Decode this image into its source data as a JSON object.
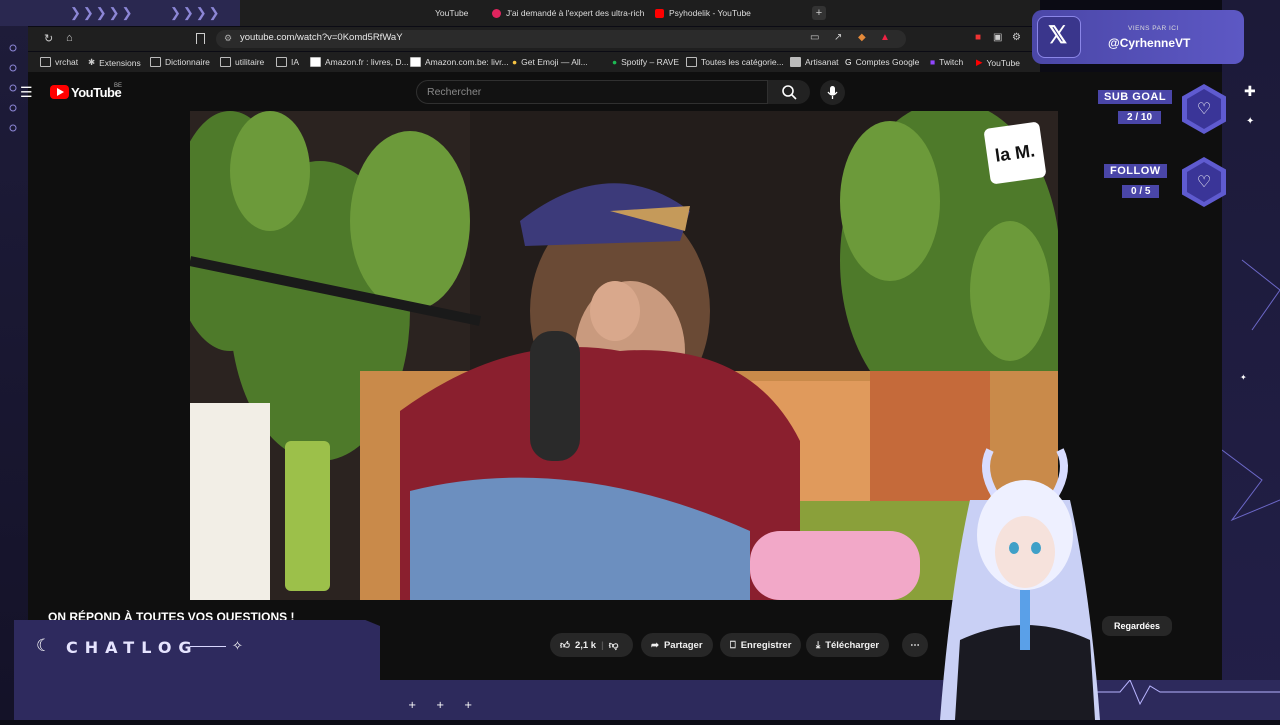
{
  "browser": {
    "tabs": [
      {
        "label": "YouTube",
        "active": false
      },
      {
        "label": "J'ai demandé à l'expert des ultra-rich",
        "active": false
      },
      {
        "label": "Psyhodelik - YouTube",
        "active": true
      }
    ],
    "url": "youtube.com/watch?v=0Komd5RfWaY",
    "bookmarks": [
      "vrchat",
      "Extensions",
      "Dictionnaire",
      "utilitaire",
      "IA",
      "Amazon.fr : livres, D...",
      "Amazon.com.be: livr...",
      "Get Emoji — All...",
      "Spotify – RAVE",
      "Toutes les catégorie...",
      "Artisanat",
      "Comptes Google",
      "Twitch",
      "YouTube"
    ]
  },
  "youtube": {
    "logo_text": "YouTube",
    "country_code": "BE",
    "search_placeholder": "Rechercher",
    "video_title": "ON RÉPOND À TOUTES VOS QUESTIONS !",
    "channel_watermark": "la M.",
    "actions": {
      "likes": "2,1 k",
      "share": "Partager",
      "save": "Enregistrer",
      "download": "Télécharger"
    },
    "chip_watched": "Regardées"
  },
  "overlay": {
    "twitter": {
      "caption": "VIENS PAR ICI",
      "handle": "@CyrhenneVT"
    },
    "sub_goal": {
      "label": "SUB GOAL",
      "count": "2 / 10"
    },
    "follow_goal": {
      "label": "FOLLOW",
      "count": "0 / 5"
    },
    "chatlog_title": "CHATLOG",
    "accent_color": "#4a46a8"
  }
}
